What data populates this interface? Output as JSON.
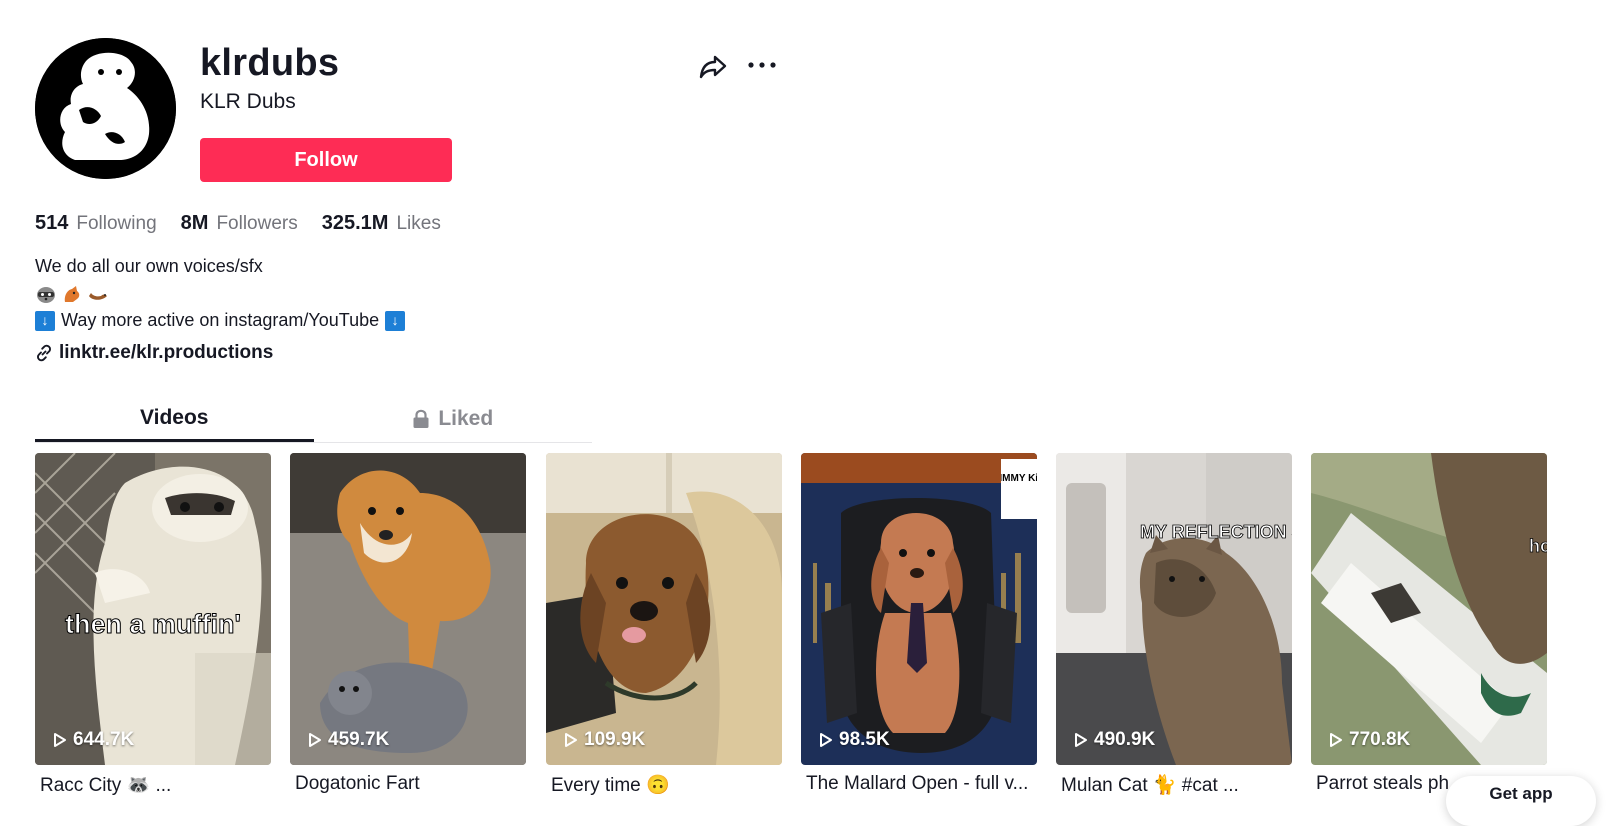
{
  "profile": {
    "username": "klrdubs",
    "nickname": "KLR Dubs",
    "follow_label": "Follow"
  },
  "stats": [
    {
      "value": "514",
      "label": "Following"
    },
    {
      "value": "8M",
      "label": "Followers"
    },
    {
      "value": "325.1M",
      "label": "Likes"
    }
  ],
  "bio": {
    "line1": "We do all our own voices/sfx",
    "emojis": [
      "raccoon",
      "dog",
      "otter"
    ],
    "line3": "Way more active on instagram/YouTube",
    "arrow_glyph": "↓"
  },
  "link": "linktr.ee/klr.productions",
  "tabs": [
    {
      "label": "Videos"
    },
    {
      "label": "Liked"
    }
  ],
  "videos": [
    {
      "views": "644.7K",
      "caption": "Racc City 🦝 ...",
      "overlay": "then a muffin'"
    },
    {
      "views": "459.7K",
      "caption": "Dogatonic Fart",
      "overlay": ""
    },
    {
      "views": "109.9K",
      "caption": "Every time 🙃",
      "overlay": ""
    },
    {
      "views": "98.5K",
      "caption": "The Mallard Open - full v...",
      "overlay": "JIMMY Kib"
    },
    {
      "views": "490.9K",
      "caption": "Mulan Cat 🐈 #cat ...",
      "overlay": "MY REFLECTION SH"
    },
    {
      "views": "770.8K",
      "caption": "Parrot steals ph",
      "overlay": "ho"
    }
  ],
  "get_app": "Get app",
  "colors": {
    "accent": "#fe2c55",
    "text": "#161823",
    "muted": "#73747b"
  }
}
